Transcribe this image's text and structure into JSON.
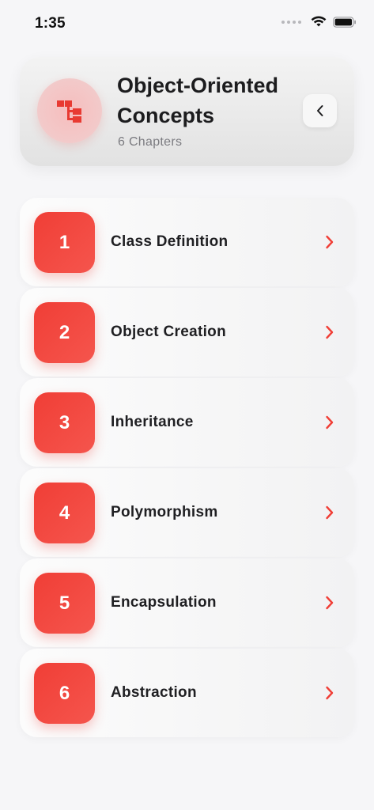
{
  "status_bar": {
    "time": "1:35"
  },
  "header": {
    "title": "Object-Oriented Concepts",
    "subtitle": "6 Chapters",
    "icon": "hierarchy-icon",
    "back_icon": "chevron-left-icon"
  },
  "chapters": [
    {
      "number": "1",
      "title": "Class Definition"
    },
    {
      "number": "2",
      "title": "Object Creation"
    },
    {
      "number": "3",
      "title": "Inheritance"
    },
    {
      "number": "4",
      "title": "Polymorphism"
    },
    {
      "number": "5",
      "title": "Encapsulation"
    },
    {
      "number": "6",
      "title": "Abstraction"
    }
  ],
  "colors": {
    "accent": "#f03e36",
    "background": "#f6f6f8",
    "text": "#1c1c1e",
    "subtext": "#7b7b80"
  }
}
